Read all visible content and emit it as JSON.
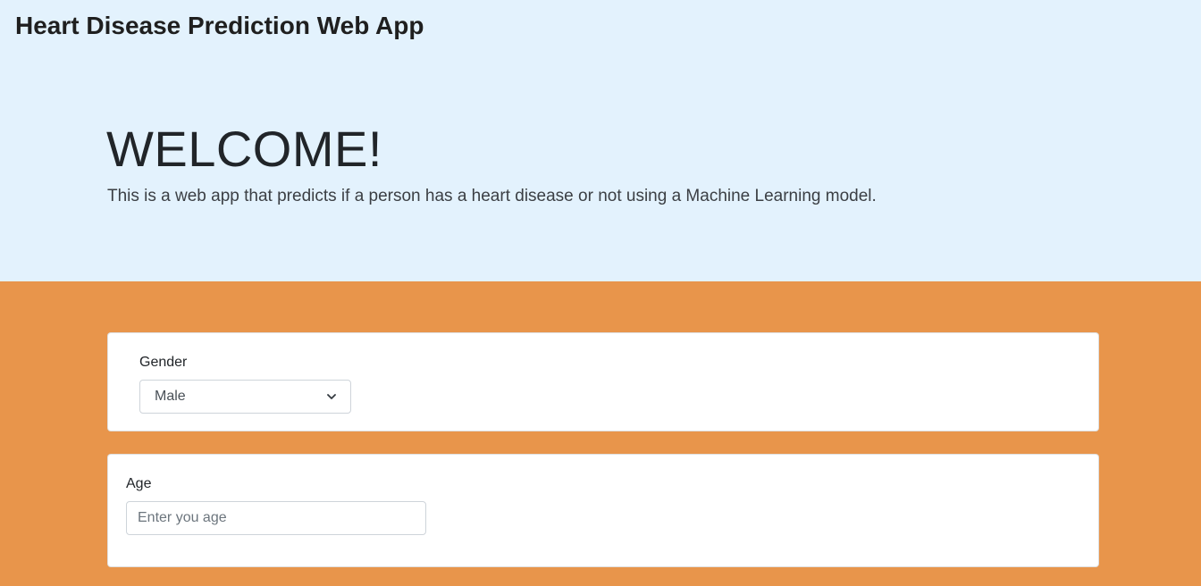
{
  "header": {
    "app_title": "Heart Disease Prediction Web App"
  },
  "jumbotron": {
    "heading": "WELCOME!",
    "lead": "This is a web app that predicts if a person has a heart disease or not using a Machine Learning model."
  },
  "form": {
    "gender": {
      "label": "Gender",
      "selected": "Male",
      "icon": "chevron-down-icon"
    },
    "age": {
      "label": "Age",
      "placeholder": "Enter you age",
      "value": ""
    }
  },
  "colors": {
    "header_bg": "#e3f2fd",
    "form_bg": "#e8954b",
    "card_bg": "#ffffff"
  }
}
